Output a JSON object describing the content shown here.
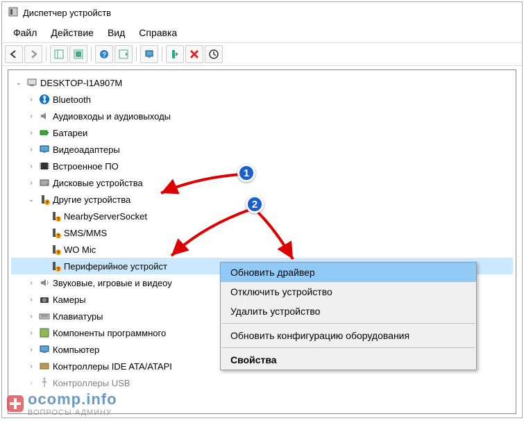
{
  "title": "Диспетчер устройств",
  "menus": {
    "file": "Файл",
    "action": "Действие",
    "view": "Вид",
    "help": "Справка"
  },
  "root": "DESKTOP-I1A907M",
  "nodes": [
    {
      "label": "Bluetooth",
      "icon": "bluetooth"
    },
    {
      "label": "Аудиовходы и аудиовыходы",
      "icon": "audio"
    },
    {
      "label": "Батареи",
      "icon": "battery"
    },
    {
      "label": "Видеоадаптеры",
      "icon": "display"
    },
    {
      "label": "Встроенное ПО",
      "icon": "chip"
    },
    {
      "label": "Дисковые устройства",
      "icon": "disk"
    },
    {
      "label": "Другие устройства",
      "icon": "unknown",
      "expanded": true
    },
    {
      "label": "Звуковые, игровые и видеоу",
      "icon": "sound"
    },
    {
      "label": "Камеры",
      "icon": "camera"
    },
    {
      "label": "Клавиатуры",
      "icon": "keyboard"
    },
    {
      "label": "Компоненты программного",
      "icon": "software"
    },
    {
      "label": "Компьютер",
      "icon": "computer"
    },
    {
      "label": "Контроллеры IDE ATA/ATAPI",
      "icon": "controller"
    },
    {
      "label": "Контроллеры USB",
      "icon": "usb"
    }
  ],
  "other_children": [
    {
      "label": "NearbyServerSocket"
    },
    {
      "label": "SMS/MMS"
    },
    {
      "label": "WO Mic"
    },
    {
      "label": "Периферийное устройст",
      "selected": true
    }
  ],
  "ctx": {
    "update": "Обновить драйвер",
    "disable": "Отключить устройство",
    "delete": "Удалить устройство",
    "scan": "Обновить конфигурацию оборудования",
    "props": "Свойства"
  },
  "badges": {
    "one": "1",
    "two": "2"
  },
  "watermark": {
    "line1": "ocomp.info",
    "line2": "ВОПРОСЫ АДМИНУ"
  }
}
